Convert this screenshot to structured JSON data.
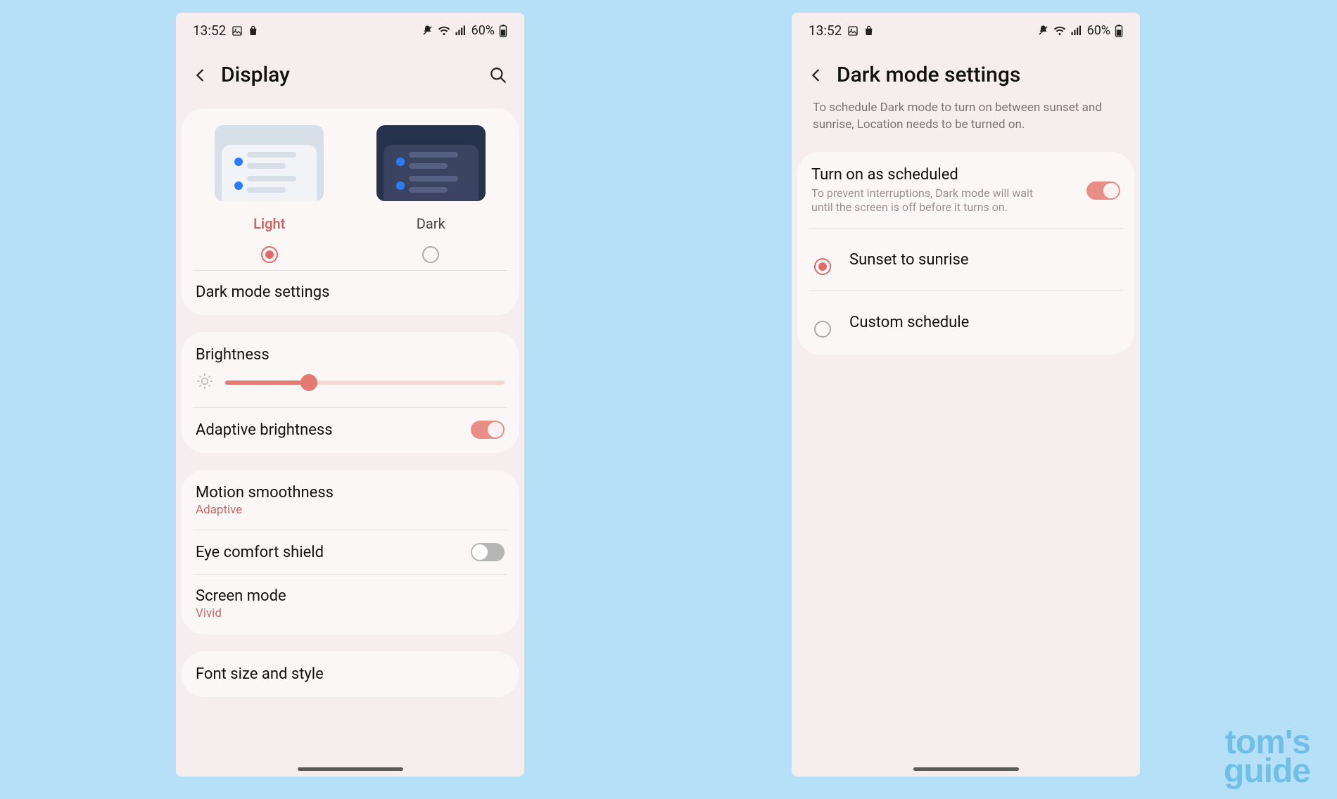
{
  "status": {
    "time": "13:52",
    "battery_text": "60%"
  },
  "phone1": {
    "header": {
      "title": "Display"
    },
    "theme": {
      "light_label": "Light",
      "dark_label": "Dark",
      "selected": "light"
    },
    "dark_mode_settings_label": "Dark mode settings",
    "brightness": {
      "label": "Brightness",
      "percent": 30
    },
    "adaptive_brightness": {
      "label": "Adaptive brightness",
      "on": true
    },
    "motion_smoothness": {
      "label": "Motion smoothness",
      "value": "Adaptive"
    },
    "eye_comfort": {
      "label": "Eye comfort shield",
      "on": false
    },
    "screen_mode": {
      "label": "Screen mode",
      "value": "Vivid"
    },
    "font_label": "Font size and style"
  },
  "phone2": {
    "header": {
      "title": "Dark mode settings"
    },
    "description": "To schedule Dark mode to turn on between sunset and sunrise, Location needs to be turned on.",
    "scheduled": {
      "label": "Turn on as scheduled",
      "desc": "To prevent interruptions, Dark mode will wait until the screen is off before it turns on.",
      "on": true
    },
    "option_sunset": "Sunset to sunrise",
    "option_custom": "Custom schedule",
    "selected_option": "sunset"
  },
  "watermark": {
    "line1": "tom's",
    "line2": "guide"
  }
}
